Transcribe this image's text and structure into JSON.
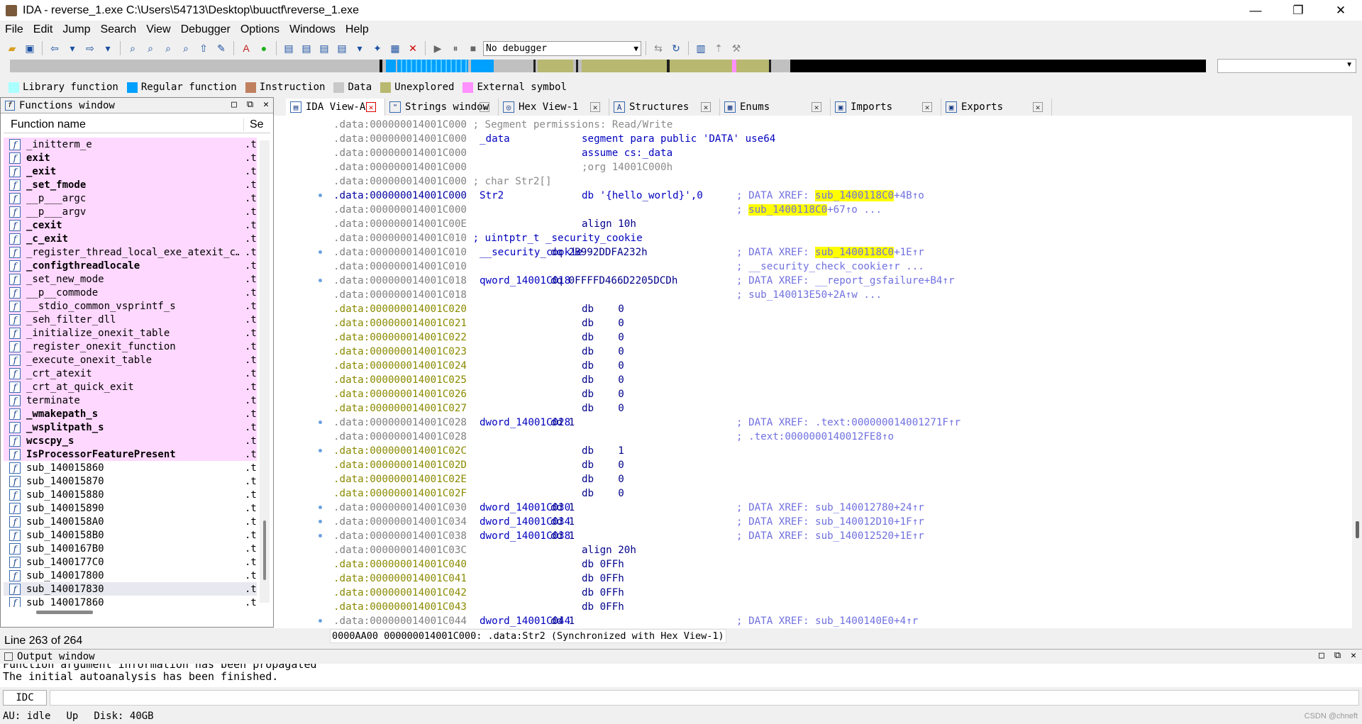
{
  "window": {
    "title": "IDA - reverse_1.exe C:\\Users\\54713\\Desktop\\buuctf\\reverse_1.exe",
    "minimize": "—",
    "maximize": "❐",
    "close": "✕"
  },
  "menu": [
    "File",
    "Edit",
    "Jump",
    "Search",
    "View",
    "Debugger",
    "Options",
    "Windows",
    "Help"
  ],
  "toolbar": {
    "debugger_select": "No debugger"
  },
  "legend": [
    {
      "label": "Library function",
      "color": "#aaffff"
    },
    {
      "label": "Regular function",
      "color": "#00a0ff"
    },
    {
      "label": "Instruction",
      "color": "#c08060"
    },
    {
      "label": "Data",
      "color": "#c8c8c8"
    },
    {
      "label": "Unexplored",
      "color": "#b8b870"
    },
    {
      "label": "External symbol",
      "color": "#ff90ff"
    }
  ],
  "functions_window": {
    "title": "Functions window",
    "col_name": "Function name",
    "col_segment": "Se",
    "status": "Line 263 of 264",
    "rows": [
      {
        "name": "_initterm_e",
        "seg": ".t",
        "lib": true,
        "bold": false
      },
      {
        "name": "exit",
        "seg": ".t",
        "lib": true,
        "bold": true
      },
      {
        "name": "_exit",
        "seg": ".t",
        "lib": true,
        "bold": true
      },
      {
        "name": "_set_fmode",
        "seg": ".t",
        "lib": true,
        "bold": true
      },
      {
        "name": "__p___argc",
        "seg": ".t",
        "lib": true,
        "bold": false
      },
      {
        "name": "__p___argv",
        "seg": ".t",
        "lib": true,
        "bold": false
      },
      {
        "name": "_cexit",
        "seg": ".t",
        "lib": true,
        "bold": true
      },
      {
        "name": "_c_exit",
        "seg": ".t",
        "lib": true,
        "bold": true
      },
      {
        "name": "_register_thread_local_exe_atexit_c…",
        "seg": ".t",
        "lib": true,
        "bold": false
      },
      {
        "name": "_configthreadlocale",
        "seg": ".t",
        "lib": true,
        "bold": true
      },
      {
        "name": "_set_new_mode",
        "seg": ".t",
        "lib": true,
        "bold": false
      },
      {
        "name": "__p__commode",
        "seg": ".t",
        "lib": true,
        "bold": false
      },
      {
        "name": "__stdio_common_vsprintf_s",
        "seg": ".t",
        "lib": true,
        "bold": false
      },
      {
        "name": "_seh_filter_dll",
        "seg": ".t",
        "lib": true,
        "bold": false
      },
      {
        "name": "_initialize_onexit_table",
        "seg": ".t",
        "lib": true,
        "bold": false
      },
      {
        "name": "_register_onexit_function",
        "seg": ".t",
        "lib": true,
        "bold": false
      },
      {
        "name": "_execute_onexit_table",
        "seg": ".t",
        "lib": true,
        "bold": false
      },
      {
        "name": "_crt_atexit",
        "seg": ".t",
        "lib": true,
        "bold": false
      },
      {
        "name": "_crt_at_quick_exit",
        "seg": ".t",
        "lib": true,
        "bold": false
      },
      {
        "name": "terminate",
        "seg": ".t",
        "lib": true,
        "bold": false
      },
      {
        "name": "_wmakepath_s",
        "seg": ".t",
        "lib": true,
        "bold": true
      },
      {
        "name": "_wsplitpath_s",
        "seg": ".t",
        "lib": true,
        "bold": true
      },
      {
        "name": "wcscpy_s",
        "seg": ".t",
        "lib": true,
        "bold": true
      },
      {
        "name": "IsProcessorFeaturePresent",
        "seg": ".t",
        "lib": true,
        "bold": true
      },
      {
        "name": "sub_140015860",
        "seg": ".t",
        "lib": false,
        "bold": false
      },
      {
        "name": "sub_140015870",
        "seg": ".t",
        "lib": false,
        "bold": false
      },
      {
        "name": "sub_140015880",
        "seg": ".t",
        "lib": false,
        "bold": false
      },
      {
        "name": "sub_140015890",
        "seg": ".t",
        "lib": false,
        "bold": false
      },
      {
        "name": "sub_1400158A0",
        "seg": ".t",
        "lib": false,
        "bold": false
      },
      {
        "name": "sub_1400158B0",
        "seg": ".t",
        "lib": false,
        "bold": false
      },
      {
        "name": "sub_1400167B0",
        "seg": ".t",
        "lib": false,
        "bold": false
      },
      {
        "name": "sub_1400177C0",
        "seg": ".t",
        "lib": false,
        "bold": false
      },
      {
        "name": "sub_140017800",
        "seg": ".t",
        "lib": false,
        "bold": false
      },
      {
        "name": "sub_140017830",
        "seg": ".t",
        "lib": false,
        "bold": false,
        "selected": true
      },
      {
        "name": "sub_140017860",
        "seg": ".t",
        "lib": false,
        "bold": false
      }
    ]
  },
  "tabs": [
    {
      "label": "IDA View-A",
      "icon": "ida-view-icon",
      "active": true
    },
    {
      "label": "Strings window",
      "icon": "strings-icon",
      "active": false
    },
    {
      "label": "Hex View-1",
      "icon": "hex-icon",
      "active": false
    },
    {
      "label": "Structures",
      "icon": "structures-icon",
      "active": false
    },
    {
      "label": "Enums",
      "icon": "enums-icon",
      "active": false
    },
    {
      "label": "Imports",
      "icon": "imports-icon",
      "active": false
    },
    {
      "label": "Exports",
      "icon": "exports-icon",
      "active": false
    }
  ],
  "listing": [
    {
      "addr": ".data:000000014001C000",
      "text": " ; Segment permissions: Read/Write",
      "kind": "comment"
    },
    {
      "addr": ".data:000000014001C000",
      "label": "_data",
      "ins": "segment para public 'DATA' use64",
      "kind": "blue"
    },
    {
      "addr": ".data:000000014001C000",
      "ins": "assume cs:_data",
      "kind": "blue"
    },
    {
      "addr": ".data:000000014001C000",
      "ins": ";org 14001C000h",
      "kind": "comment"
    },
    {
      "addr": ".data:000000014001C000",
      "text": " ; char Str2[]",
      "kind": "comment"
    },
    {
      "addr": ".data:000000014001C000",
      "label": "Str2",
      "ins": "db '{hello_world}',0",
      "xref_pre": "; DATA XREF: ",
      "xref_hl": "sub_1400118C0",
      "xref_post": "+4B↑o",
      "kind": "hl",
      "dot": true
    },
    {
      "addr": ".data:000000014001C000",
      "xref_pre": "; ",
      "xref_hl": "sub_1400118C0",
      "xref_post": "+67↑o ...",
      "kind": "normal"
    },
    {
      "addr": ".data:000000014001C00E",
      "ins": "align 10h",
      "kind": "normal"
    },
    {
      "addr": ".data:000000014001C010",
      "text": " ; uintptr_t _security_cookie",
      "kind": "bluetext"
    },
    {
      "addr": ".data:000000014001C010",
      "label": "__security_cookie",
      "ins2": "dq 2B992DDFA232h",
      "xref_pre": "; DATA XREF: ",
      "xref_hl": "sub_1400118C0",
      "xref_post": "+1E↑r",
      "kind": "normal",
      "dot": true
    },
    {
      "addr": ".data:000000014001C010",
      "xref_pre": "; __security_check_cookie↑r ...",
      "kind": "normal"
    },
    {
      "addr": ".data:000000014001C018",
      "label": "qword_14001C018",
      "ins2": "dq 0FFFFD466D2205DCDh",
      "xref_pre": "; DATA XREF: __report_gsfailure+B4↑r",
      "kind": "normal",
      "dot": true
    },
    {
      "addr": ".data:000000014001C018",
      "xref_pre": "; sub_140013E50+2A↑w ...",
      "kind": "normal"
    },
    {
      "addr": ".data:000000014001C020",
      "ins": "db    0",
      "kind": "und"
    },
    {
      "addr": ".data:000000014001C021",
      "ins": "db    0",
      "kind": "und"
    },
    {
      "addr": ".data:000000014001C022",
      "ins": "db    0",
      "kind": "und"
    },
    {
      "addr": ".data:000000014001C023",
      "ins": "db    0",
      "kind": "und"
    },
    {
      "addr": ".data:000000014001C024",
      "ins": "db    0",
      "kind": "und"
    },
    {
      "addr": ".data:000000014001C025",
      "ins": "db    0",
      "kind": "und"
    },
    {
      "addr": ".data:000000014001C026",
      "ins": "db    0",
      "kind": "und"
    },
    {
      "addr": ".data:000000014001C027",
      "ins": "db    0",
      "kind": "und"
    },
    {
      "addr": ".data:000000014001C028",
      "label": "dword_14001C028",
      "ins2": "dd 1",
      "xref_pre": "; DATA XREF: .text:000000014001271F↑r",
      "kind": "normal",
      "dot": true
    },
    {
      "addr": ".data:000000014001C028",
      "xref_pre": "; .text:0000000140012FE8↑o",
      "kind": "normal"
    },
    {
      "addr": ".data:000000014001C02C",
      "ins": "db    1",
      "kind": "und",
      "dot": true
    },
    {
      "addr": ".data:000000014001C02D",
      "ins": "db    0",
      "kind": "und"
    },
    {
      "addr": ".data:000000014001C02E",
      "ins": "db    0",
      "kind": "und"
    },
    {
      "addr": ".data:000000014001C02F",
      "ins": "db    0",
      "kind": "und"
    },
    {
      "addr": ".data:000000014001C030",
      "label": "dword_14001C030",
      "ins2": "dd 1",
      "xref_pre": "; DATA XREF: sub_140012780+24↑r",
      "kind": "normal",
      "dot": true
    },
    {
      "addr": ".data:000000014001C034",
      "label": "dword_14001C034",
      "ins2": "dd 1",
      "xref_pre": "; DATA XREF: sub_140012D10+1F↑r",
      "kind": "normal",
      "dot": true
    },
    {
      "addr": ".data:000000014001C038",
      "label": "dword_14001C038",
      "ins2": "dd 1",
      "xref_pre": "; DATA XREF: sub_140012520+1E↑r",
      "kind": "normal",
      "dot": true
    },
    {
      "addr": ".data:000000014001C03C",
      "ins": "align 20h",
      "kind": "normal"
    },
    {
      "addr": ".data:000000014001C040",
      "ins": "db 0FFh",
      "kind": "und"
    },
    {
      "addr": ".data:000000014001C041",
      "ins": "db 0FFh",
      "kind": "und"
    },
    {
      "addr": ".data:000000014001C042",
      "ins": "db 0FFh",
      "kind": "und"
    },
    {
      "addr": ".data:000000014001C043",
      "ins": "db 0FFh",
      "kind": "und"
    },
    {
      "addr": ".data:000000014001C044",
      "label": "dword_14001C044",
      "ins2": "dd 1",
      "xref_pre": "; DATA XREF: sub_1400140E0+4↑r",
      "kind": "normal",
      "dot": true
    }
  ],
  "sync_status": "0000AA00 000000014001C000: .data:Str2 (Synchronized with Hex View-1)",
  "output_window": {
    "title": "Output window",
    "lines": [
      "Function argument information has been propagated",
      "The initial autoanalysis has been finished."
    ],
    "idc_label": "IDC"
  },
  "statusbar": {
    "au": "AU:",
    "au_state": "idle",
    "dir": "Up",
    "disk": "Disk: 40GB",
    "watermark": "CSDN @chneft"
  }
}
